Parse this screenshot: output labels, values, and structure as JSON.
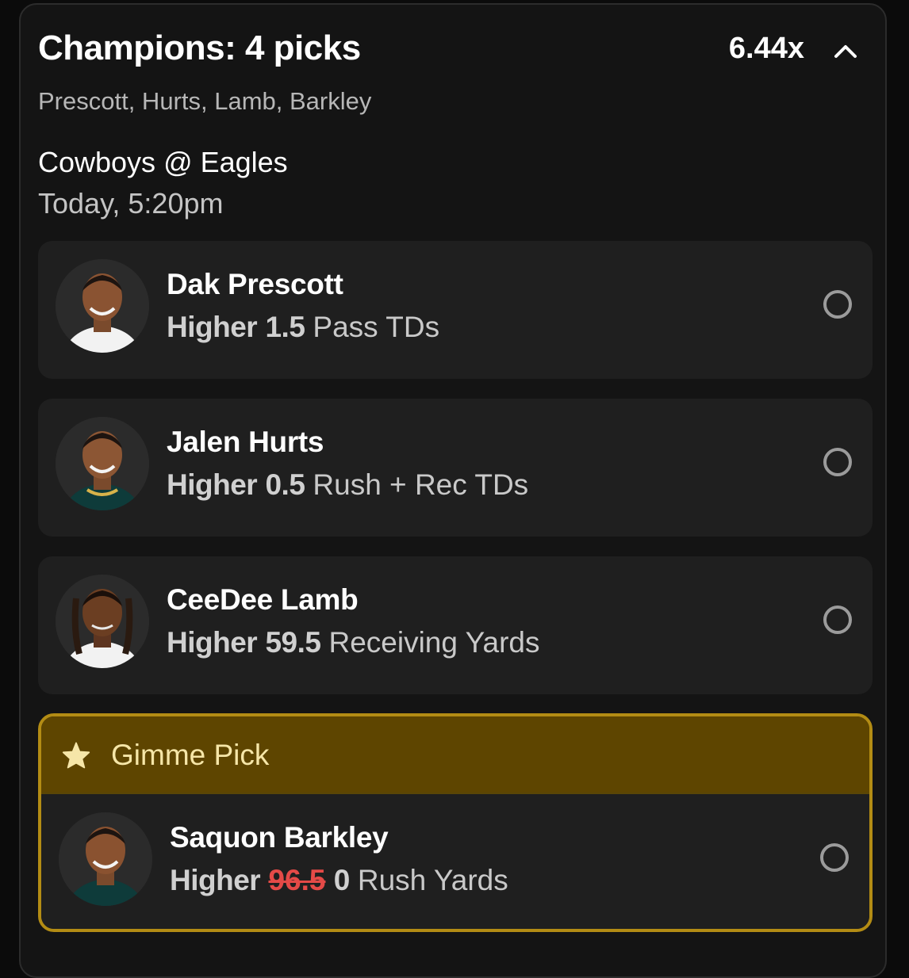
{
  "header": {
    "title": "Champions: 4 picks",
    "multiplier": "6.44x",
    "players_summary": "Prescott, Hurts, Lamb, Barkley"
  },
  "game": {
    "matchup": "Cowboys @ Eagles",
    "time": "Today, 5:20pm"
  },
  "picks": [
    {
      "name": "Dak Prescott",
      "direction": "Higher",
      "line": "1.5",
      "stat": "Pass TDs"
    },
    {
      "name": "Jalen Hurts",
      "direction": "Higher",
      "line": "0.5",
      "stat": "Rush + Rec TDs"
    },
    {
      "name": "CeeDee Lamb",
      "direction": "Higher",
      "line": "59.5",
      "stat": "Receiving Yards"
    }
  ],
  "gimme": {
    "label": "Gimme Pick",
    "pick": {
      "name": "Saquon Barkley",
      "direction": "Higher",
      "original_line": "96.5",
      "line": "0",
      "stat": "Rush Yards"
    }
  },
  "icons": {
    "collapse": "chevron-up-icon",
    "gimme": "star-icon",
    "select": "radio-circle-icon"
  },
  "colors": {
    "background": "#141414",
    "gimme_border": "#b38c14",
    "gimme_banner": "#5e4500",
    "strike": "#e44a47"
  }
}
